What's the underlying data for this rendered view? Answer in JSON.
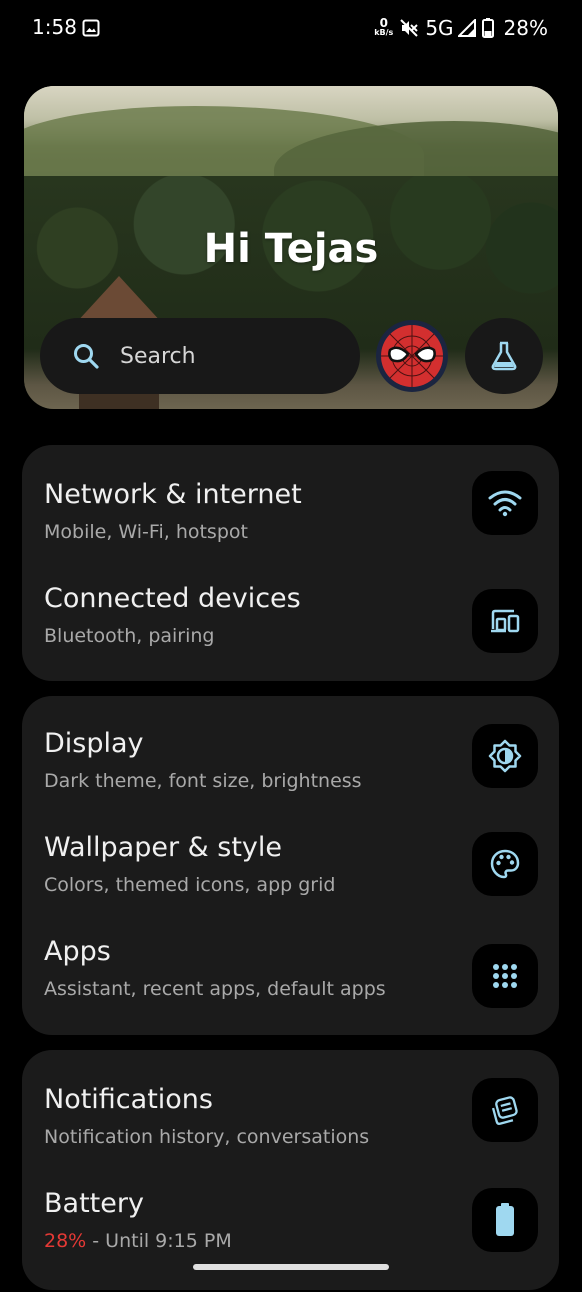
{
  "status_bar": {
    "time": "1:58",
    "net_speed_value": "0",
    "net_speed_unit": "kB/s",
    "network": "5G",
    "battery": "28%"
  },
  "header": {
    "greeting": "Hi Tejas",
    "search_placeholder": "Search"
  },
  "colors": {
    "accent": "#8fd6ee",
    "card": "#1b1b1b",
    "battery_low": "#e53935"
  },
  "sections": [
    {
      "items": [
        {
          "title": "Network & internet",
          "subtitle": "Mobile, Wi-Fi, hotspot",
          "icon": "wifi-icon"
        },
        {
          "title": "Connected devices",
          "subtitle": "Bluetooth, pairing",
          "icon": "devices-icon"
        }
      ]
    },
    {
      "items": [
        {
          "title": "Display",
          "subtitle": "Dark theme, font size, brightness",
          "icon": "brightness-icon"
        },
        {
          "title": "Wallpaper & style",
          "subtitle": "Colors, themed icons, app grid",
          "icon": "palette-icon"
        },
        {
          "title": "Apps",
          "subtitle": "Assistant, recent apps, default apps",
          "icon": "apps-grid-icon"
        }
      ]
    },
    {
      "items": [
        {
          "title": "Notifications",
          "subtitle": "Notification history, conversations",
          "icon": "notifications-icon"
        },
        {
          "title": "Battery",
          "subtitle_pct": "28%",
          "subtitle_rest": " - Until 9:15 PM",
          "icon": "battery-icon"
        }
      ]
    }
  ]
}
